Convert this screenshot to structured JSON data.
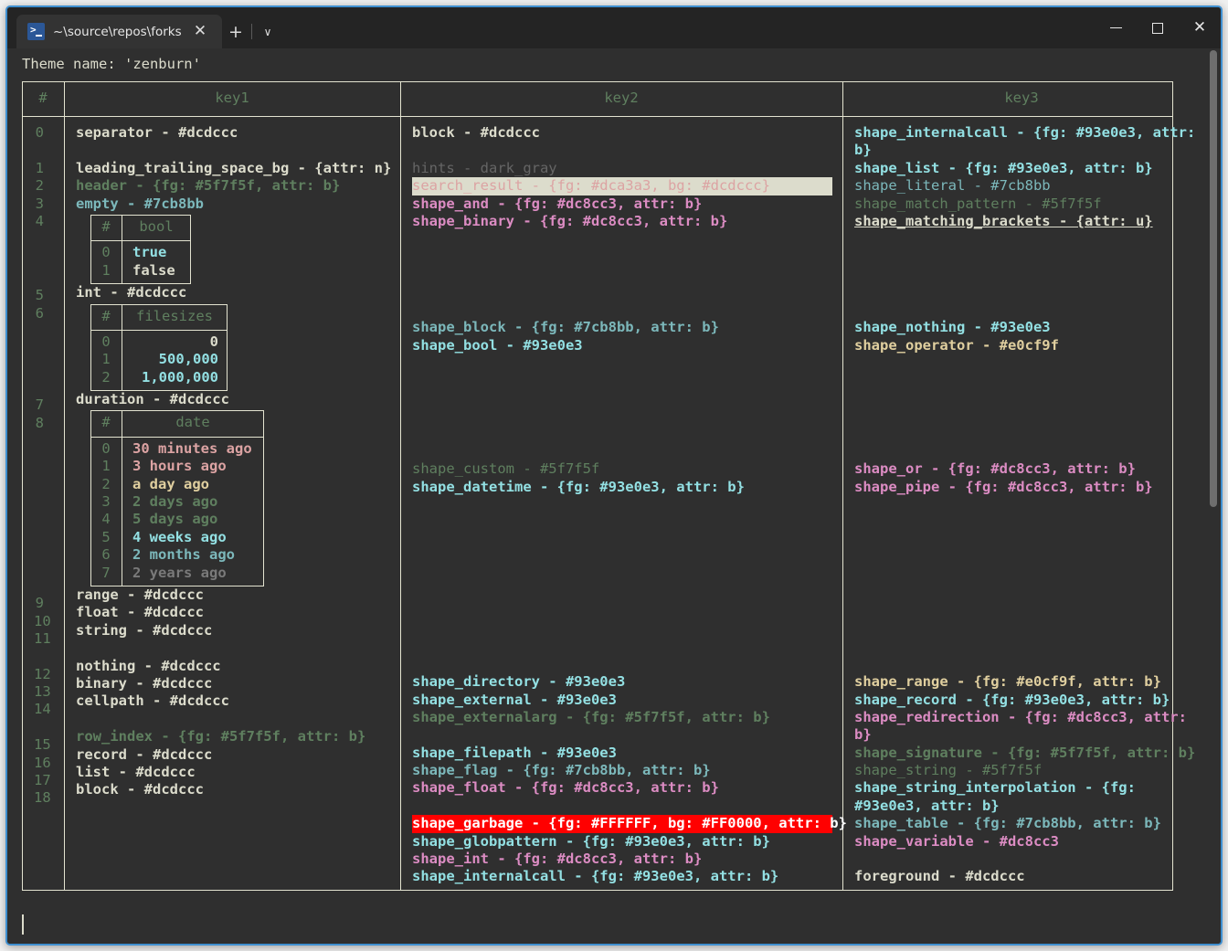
{
  "window": {
    "tab_title": "~\\source\\repos\\forks\\nu_scrip",
    "tab_icon": "powershell-icon",
    "close_label": "✕",
    "new_tab_label": "+",
    "dropdown_label": "∨",
    "minimize_label": "minimize",
    "maximize_label": "maximize",
    "close_window_label": "✕"
  },
  "terminal": {
    "theme_line": "Theme name: 'zenburn'",
    "prompt_cursor": ""
  },
  "table": {
    "headers": [
      "#",
      "key1",
      "key2",
      "key3"
    ],
    "row_indices": [
      "0",
      "1",
      "2",
      "3",
      "4",
      "5",
      "6",
      "7",
      "8",
      "9",
      "10",
      "11",
      "12",
      "13",
      "14",
      "15",
      "16",
      "17",
      "18"
    ]
  },
  "key1": {
    "blocks": [
      {
        "index": "0",
        "text": "separator - #dcdccc",
        "style": "c-fg b"
      },
      {
        "index": "",
        "text": "",
        "style": ""
      },
      {
        "index": "1",
        "text": "leading_trailing_space_bg - {attr: n}",
        "style": "c-fg b"
      },
      {
        "index": "2",
        "text": "header - {fg: #5f7f5f, attr: b}",
        "style": "c-green b"
      },
      {
        "index": "3",
        "text": "empty - #7cb8bb",
        "style": "c-teal b"
      },
      {
        "index": "4",
        "text": "",
        "style": "subtable-bool"
      },
      {
        "index": "5",
        "text": "int - #dcdccc",
        "style": "c-fg b"
      },
      {
        "index": "6",
        "text": "",
        "style": "subtable-filesizes"
      },
      {
        "index": "7",
        "text": "duration - #dcdccc",
        "style": "c-fg b"
      },
      {
        "index": "8",
        "text": "",
        "style": "subtable-date"
      },
      {
        "index": "9",
        "text": "range - #dcdccc",
        "style": "c-fg b"
      },
      {
        "index": "10",
        "text": "float - #dcdccc",
        "style": "c-fg b"
      },
      {
        "index": "11",
        "text": "string - #dcdccc",
        "style": "c-fg b"
      },
      {
        "index": "",
        "text": "",
        "style": ""
      },
      {
        "index": "12",
        "text": "nothing - #dcdccc",
        "style": "c-fg b"
      },
      {
        "index": "13",
        "text": "binary - #dcdccc",
        "style": "c-fg b"
      },
      {
        "index": "14",
        "text": "cellpath - #dcdccc",
        "style": "c-fg b"
      },
      {
        "index": "",
        "text": "",
        "style": ""
      },
      {
        "index": "15",
        "text": "row_index - {fg: #5f7f5f, attr: b}",
        "style": "c-green b"
      },
      {
        "index": "16",
        "text": "record - #dcdccc",
        "style": "c-fg b"
      },
      {
        "index": "17",
        "text": "list - #dcdccc",
        "style": "c-fg b"
      },
      {
        "index": "18",
        "text": "block - #dcdccc",
        "style": "c-fg b"
      }
    ]
  },
  "key2": {
    "lines": [
      {
        "text": "block - #dcdccc",
        "style": "c-fg b"
      },
      {
        "text": "",
        "style": ""
      },
      {
        "text": "hints - dark_gray",
        "style": "c-dimgray"
      },
      {
        "text": "search_result - {fg: #dca3a3, bg: #dcdccc}",
        "style": "hl-search"
      },
      {
        "text": "shape_and - {fg: #dc8cc3, attr: b}",
        "style": "c-pink b"
      },
      {
        "text": "shape_binary - {fg: #dc8cc3, attr: b}",
        "style": "c-pink b"
      },
      {
        "text": "",
        "style": ""
      },
      {
        "text": "",
        "style": ""
      },
      {
        "text": "",
        "style": ""
      },
      {
        "text": "",
        "style": ""
      },
      {
        "text": "",
        "style": ""
      },
      {
        "text": "shape_block - {fg: #7cb8bb, attr: b}",
        "style": "c-teal b"
      },
      {
        "text": "shape_bool - #93e0e3",
        "style": "c-cyan b"
      },
      {
        "text": "",
        "style": ""
      },
      {
        "text": "",
        "style": ""
      },
      {
        "text": "",
        "style": ""
      },
      {
        "text": "",
        "style": ""
      },
      {
        "text": "",
        "style": ""
      },
      {
        "text": "",
        "style": ""
      },
      {
        "text": "shape_custom - #5f7f5f",
        "style": "c-green"
      },
      {
        "text": "shape_datetime - {fg: #93e0e3, attr: b}",
        "style": "c-cyan b"
      },
      {
        "text": "",
        "style": ""
      },
      {
        "text": "",
        "style": ""
      },
      {
        "text": "",
        "style": ""
      },
      {
        "text": "",
        "style": ""
      },
      {
        "text": "",
        "style": ""
      },
      {
        "text": "",
        "style": ""
      },
      {
        "text": "",
        "style": ""
      },
      {
        "text": "",
        "style": ""
      },
      {
        "text": "",
        "style": ""
      },
      {
        "text": "",
        "style": ""
      },
      {
        "text": "shape_directory - #93e0e3",
        "style": "c-cyan b"
      },
      {
        "text": "shape_external - #93e0e3",
        "style": "c-cyan b"
      },
      {
        "text": "shape_externalarg - {fg: #5f7f5f, attr: b}",
        "style": "c-green b"
      },
      {
        "text": "",
        "style": ""
      },
      {
        "text": "shape_filepath - #93e0e3",
        "style": "c-cyan b"
      },
      {
        "text": "shape_flag - {fg: #7cb8bb, attr: b}",
        "style": "c-teal b"
      },
      {
        "text": "shape_float - {fg: #dc8cc3, attr: b}",
        "style": "c-pink b"
      },
      {
        "text": "",
        "style": ""
      },
      {
        "text": "shape_garbage - {fg: #FFFFFF, bg: #FF0000, attr: b}",
        "style": "hl-garbage"
      },
      {
        "text": "shape_globpattern - {fg: #93e0e3, attr: b}",
        "style": "c-cyan b"
      },
      {
        "text": "shape_int - {fg: #dc8cc3, attr: b}",
        "style": "c-pink b"
      },
      {
        "text": "shape_internalcall - {fg: #93e0e3, attr: b}",
        "style": "c-cyan b"
      }
    ]
  },
  "key3": {
    "lines": [
      {
        "text": "shape_internalcall - {fg: #93e0e3, attr:",
        "style": "c-cyan b"
      },
      {
        "text": "b}",
        "style": "c-cyan b"
      },
      {
        "text": "shape_list - {fg: #93e0e3, attr: b}",
        "style": "c-cyan b"
      },
      {
        "text": "shape_literal - #7cb8bb",
        "style": "c-teal"
      },
      {
        "text": "shape_match_pattern - #5f7f5f",
        "style": "c-green"
      },
      {
        "text": "shape_matching_brackets - {attr: u}",
        "style": "c-fg b u"
      },
      {
        "text": "",
        "style": ""
      },
      {
        "text": "",
        "style": ""
      },
      {
        "text": "",
        "style": ""
      },
      {
        "text": "",
        "style": ""
      },
      {
        "text": "",
        "style": ""
      },
      {
        "text": "shape_nothing - #93e0e3",
        "style": "c-cyan b"
      },
      {
        "text": "shape_operator - #e0cf9f",
        "style": "c-yellow b"
      },
      {
        "text": "",
        "style": ""
      },
      {
        "text": "",
        "style": ""
      },
      {
        "text": "",
        "style": ""
      },
      {
        "text": "",
        "style": ""
      },
      {
        "text": "",
        "style": ""
      },
      {
        "text": "",
        "style": ""
      },
      {
        "text": "shape_or - {fg: #dc8cc3, attr: b}",
        "style": "c-pink b"
      },
      {
        "text": "shape_pipe - {fg: #dc8cc3, attr: b}",
        "style": "c-pink b"
      },
      {
        "text": "",
        "style": ""
      },
      {
        "text": "",
        "style": ""
      },
      {
        "text": "",
        "style": ""
      },
      {
        "text": "",
        "style": ""
      },
      {
        "text": "",
        "style": ""
      },
      {
        "text": "",
        "style": ""
      },
      {
        "text": "",
        "style": ""
      },
      {
        "text": "",
        "style": ""
      },
      {
        "text": "",
        "style": ""
      },
      {
        "text": "",
        "style": ""
      },
      {
        "text": "shape_range - {fg: #e0cf9f, attr: b}",
        "style": "c-yellow b"
      },
      {
        "text": "shape_record - {fg: #93e0e3, attr: b}",
        "style": "c-cyan b"
      },
      {
        "text": "shape_redirection - {fg: #dc8cc3, attr:",
        "style": "c-pink b"
      },
      {
        "text": "b}",
        "style": "c-pink b"
      },
      {
        "text": "shape_signature - {fg: #5f7f5f, attr: b}",
        "style": "c-green b"
      },
      {
        "text": "shape_string - #5f7f5f",
        "style": "c-green"
      },
      {
        "text": "shape_string_interpolation - {fg:",
        "style": "c-cyan b"
      },
      {
        "text": "#93e0e3, attr: b}",
        "style": "c-cyan b"
      },
      {
        "text": "shape_table - {fg: #7cb8bb, attr: b}",
        "style": "c-teal b"
      },
      {
        "text": "shape_variable - #dc8cc3",
        "style": "c-pink b"
      },
      {
        "text": "",
        "style": ""
      },
      {
        "text": "foreground - #dcdccc",
        "style": "c-fg b"
      }
    ]
  },
  "subtable_bool": {
    "header": [
      "#",
      "bool"
    ],
    "rows": [
      {
        "index": "0",
        "value": "true",
        "style": "c-cyan b"
      },
      {
        "index": "1",
        "value": "false",
        "style": "c-fg b"
      }
    ]
  },
  "subtable_filesizes": {
    "header": [
      "#",
      "filesizes"
    ],
    "rows": [
      {
        "index": "0",
        "value": "0",
        "style": "c-fg b"
      },
      {
        "index": "1",
        "value": "500,000",
        "style": "c-cyan b"
      },
      {
        "index": "2",
        "value": "1,000,000",
        "style": "c-cyan b"
      }
    ]
  },
  "subtable_date": {
    "header": [
      "#",
      "date"
    ],
    "rows": [
      {
        "index": "0",
        "value": "30 minutes ago",
        "style": "c-rose b"
      },
      {
        "index": "1",
        "value": "3 hours ago",
        "style": "c-rose b"
      },
      {
        "index": "2",
        "value": "a day ago",
        "style": "c-yellow b"
      },
      {
        "index": "3",
        "value": "2 days ago",
        "style": "c-green b"
      },
      {
        "index": "4",
        "value": "5 days ago",
        "style": "c-green b"
      },
      {
        "index": "5",
        "value": "4 weeks ago",
        "style": "c-cyan b"
      },
      {
        "index": "6",
        "value": "2 months ago",
        "style": "c-teal b"
      },
      {
        "index": "7",
        "value": "2 years ago",
        "style": "c-gray b"
      }
    ]
  },
  "colors": {
    "border": "#e3e3d0",
    "background": "#2f2f2f",
    "foreground": "#dcdccc",
    "accent": "#3f8fd0",
    "garbage_bg": "#FF0000",
    "search_bg": "#dcdccc"
  }
}
